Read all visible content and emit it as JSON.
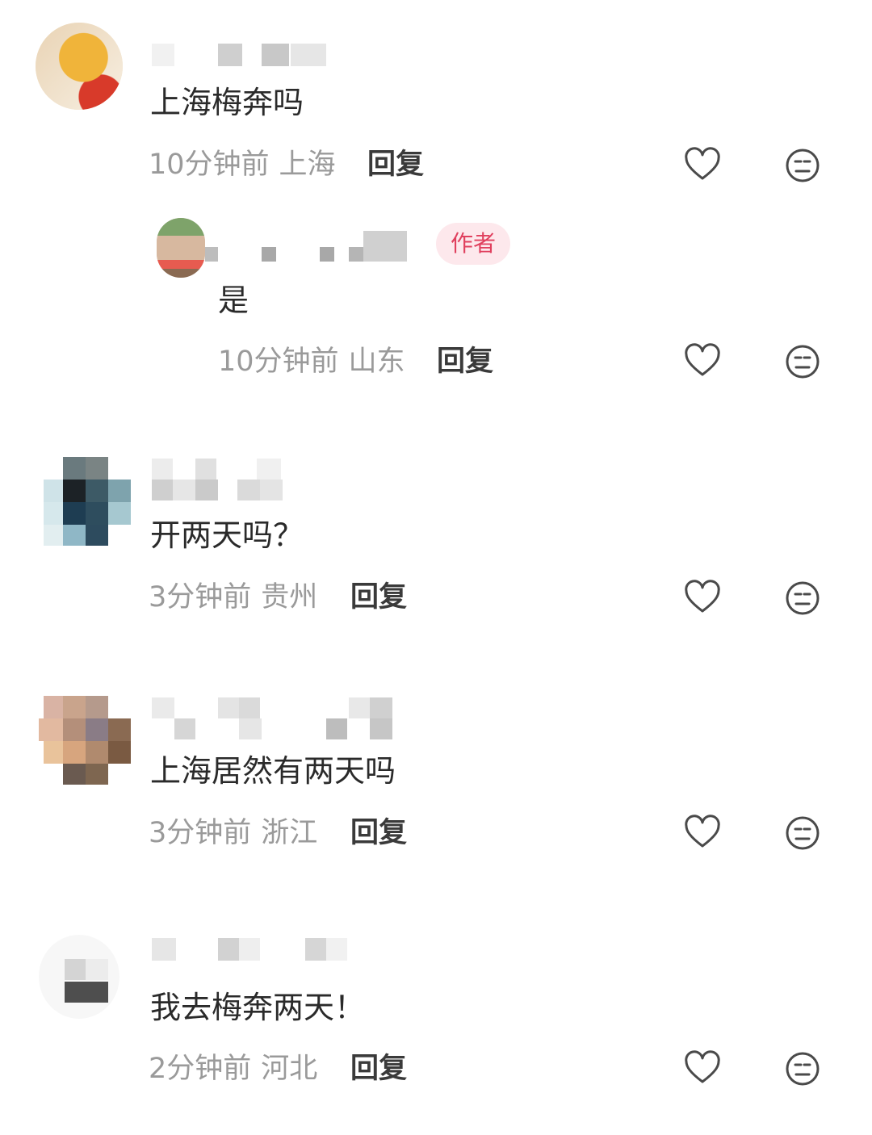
{
  "comments": [
    {
      "text": "上海梅奔吗",
      "time": "10分钟前",
      "location": "上海",
      "reply": "回复"
    },
    {
      "text": "是",
      "time": "10分钟前",
      "location": "山东",
      "reply": "回复",
      "badge": "作者"
    },
    {
      "text": "开两天吗？",
      "time": "3分钟前",
      "location": "贵州",
      "reply": "回复"
    },
    {
      "text": "上海居然有两天吗",
      "time": "3分钟前",
      "location": "浙江",
      "reply": "回复"
    },
    {
      "text": "我去梅奔两天！",
      "time": "2分钟前",
      "location": "河北",
      "reply": "回复"
    }
  ],
  "icons": {
    "like": "heart-icon",
    "dislike": "meh-face-icon"
  },
  "colors": {
    "badge_bg": "#fde8ec",
    "badge_text": "#e0405e",
    "meta": "#9a9a9a"
  }
}
